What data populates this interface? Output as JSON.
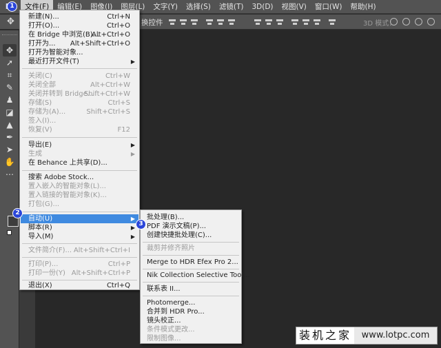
{
  "menubar": {
    "logo": "Ps",
    "items": [
      "文件(F)",
      "编辑(E)",
      "图像(I)",
      "图层(L)",
      "文字(Y)",
      "选择(S)",
      "滤镜(T)",
      "3D(D)",
      "视图(V)",
      "窗口(W)",
      "帮助(H)"
    ]
  },
  "options": {
    "controls_label": "换控件",
    "mode3d": "3D 模式："
  },
  "file_menu": {
    "new": {
      "label": "新建(N)...",
      "shortcut": "Ctrl+N"
    },
    "open": {
      "label": "打开(O)...",
      "shortcut": "Ctrl+O"
    },
    "bridge": {
      "label": "在 Bridge 中浏览(B)...",
      "shortcut": "Alt+Ctrl+O"
    },
    "open_as": {
      "label": "打开为...",
      "shortcut": "Alt+Shift+Ctrl+O"
    },
    "open_smart": {
      "label": "打开为智能对象..."
    },
    "recent": {
      "label": "最近打开文件(T)"
    },
    "close": {
      "label": "关闭(C)",
      "shortcut": "Ctrl+W"
    },
    "close_all": {
      "label": "关闭全部",
      "shortcut": "Alt+Ctrl+W"
    },
    "close_bridge": {
      "label": "关闭并转到 Bridge...",
      "shortcut": "Shift+Ctrl+W"
    },
    "save": {
      "label": "存储(S)",
      "shortcut": "Ctrl+S"
    },
    "save_as": {
      "label": "存储为(A)...",
      "shortcut": "Shift+Ctrl+S"
    },
    "checkin": {
      "label": "签入(I)..."
    },
    "revert": {
      "label": "恢复(V)",
      "shortcut": "F12"
    },
    "export": {
      "label": "导出(E)"
    },
    "generate": {
      "label": "生成"
    },
    "behance": {
      "label": "在 Behance 上共享(D)..."
    },
    "stock": {
      "label": "搜索 Adobe Stock..."
    },
    "place_embed": {
      "label": "置入嵌入的智能对象(L)..."
    },
    "place_link": {
      "label": "置入链接的智能对象(K)..."
    },
    "package": {
      "label": "打包(G)..."
    },
    "automate": {
      "label": "自动(U)"
    },
    "scripts": {
      "label": "脚本(R)"
    },
    "import": {
      "label": "导入(M)"
    },
    "file_info": {
      "label": "文件简介(F)...",
      "shortcut": "Alt+Shift+Ctrl+I"
    },
    "print": {
      "label": "打印(P)...",
      "shortcut": "Ctrl+P"
    },
    "print_one": {
      "label": "打印一份(Y)",
      "shortcut": "Alt+Shift+Ctrl+P"
    },
    "exit": {
      "label": "退出(X)",
      "shortcut": "Ctrl+Q"
    }
  },
  "automate_menu": {
    "batch": "批处理(B)...",
    "pdf": "PDF 演示文稿(P)...",
    "droplet": "创建快捷批处理(C)...",
    "crop_straighten": "裁剪并修齐照片",
    "hdr_efex": "Merge to HDR Efex Pro 2...",
    "nik": "Nik Collection Selective Tool...",
    "contact_sheet": "联系表 II...",
    "photomerge": "Photomerge...",
    "merge_hdr": "合并到 HDR Pro...",
    "lens": "镜头校正...",
    "conditional": "条件模式更改...",
    "fit_image": "限制图像..."
  },
  "badges": [
    "1",
    "2",
    "3"
  ],
  "watermark": {
    "name": "装机之家",
    "url": "www.lotpc.com"
  },
  "colors": {
    "highlight": "#3f8ae0",
    "badge": "#2b46d9",
    "ui_gray": "#535353",
    "canvas": "#282828"
  }
}
